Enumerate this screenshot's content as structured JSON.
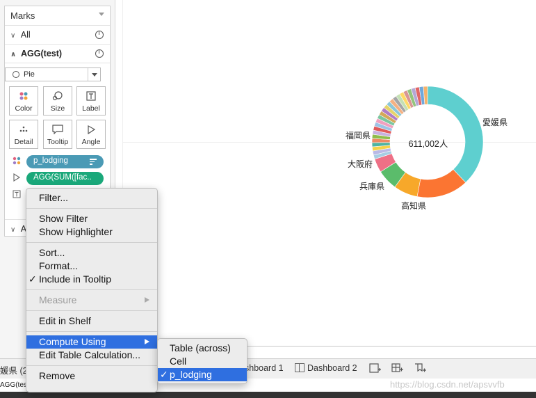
{
  "marks": {
    "title": "Marks",
    "all_label": "All",
    "layer_label": "AGG(test)",
    "mark_type": "Pie",
    "buttons": [
      "Color",
      "Size",
      "Label",
      "Detail",
      "Tooltip",
      "Angle"
    ],
    "pills": [
      "p_lodging",
      "AGG(SUM([fac.."
    ],
    "bottom_row_label": "A"
  },
  "chart": {
    "center_label": "611,002人",
    "labels": [
      "愛媛県",
      "福岡県",
      "大阪府",
      "兵庫県",
      "高知県"
    ]
  },
  "chart_data": {
    "type": "pie",
    "categories": [
      "愛媛県",
      "高知県",
      "兵庫県",
      "大阪府",
      "福岡県"
    ],
    "values": [
      38,
      15,
      7,
      6,
      4
    ]
  },
  "context_menu": {
    "items": [
      {
        "label": "Filter..."
      },
      {
        "label": "Show Filter"
      },
      {
        "label": "Show Highlighter"
      },
      {
        "label": "Sort..."
      },
      {
        "label": "Format..."
      },
      {
        "label": "Include in Tooltip",
        "checked": true
      },
      {
        "label": "Measure",
        "disabled": true,
        "submenu": true
      },
      {
        "label": "Edit in Shelf"
      },
      {
        "label": "Compute Using",
        "submenu": true,
        "active": true
      },
      {
        "label": "Edit Table Calculation..."
      },
      {
        "label": "Remove"
      }
    ],
    "submenu": [
      "Table (across)",
      "Cell",
      "p_lodging"
    ]
  },
  "tabs": {
    "left_truncated": "媛県 (2)",
    "sheet_label": "shboard 1",
    "dashboard2": "Dashboard 2",
    "status_left": "AGG(test)"
  },
  "watermark": "https://blog.csdn.net/apsvvfb"
}
